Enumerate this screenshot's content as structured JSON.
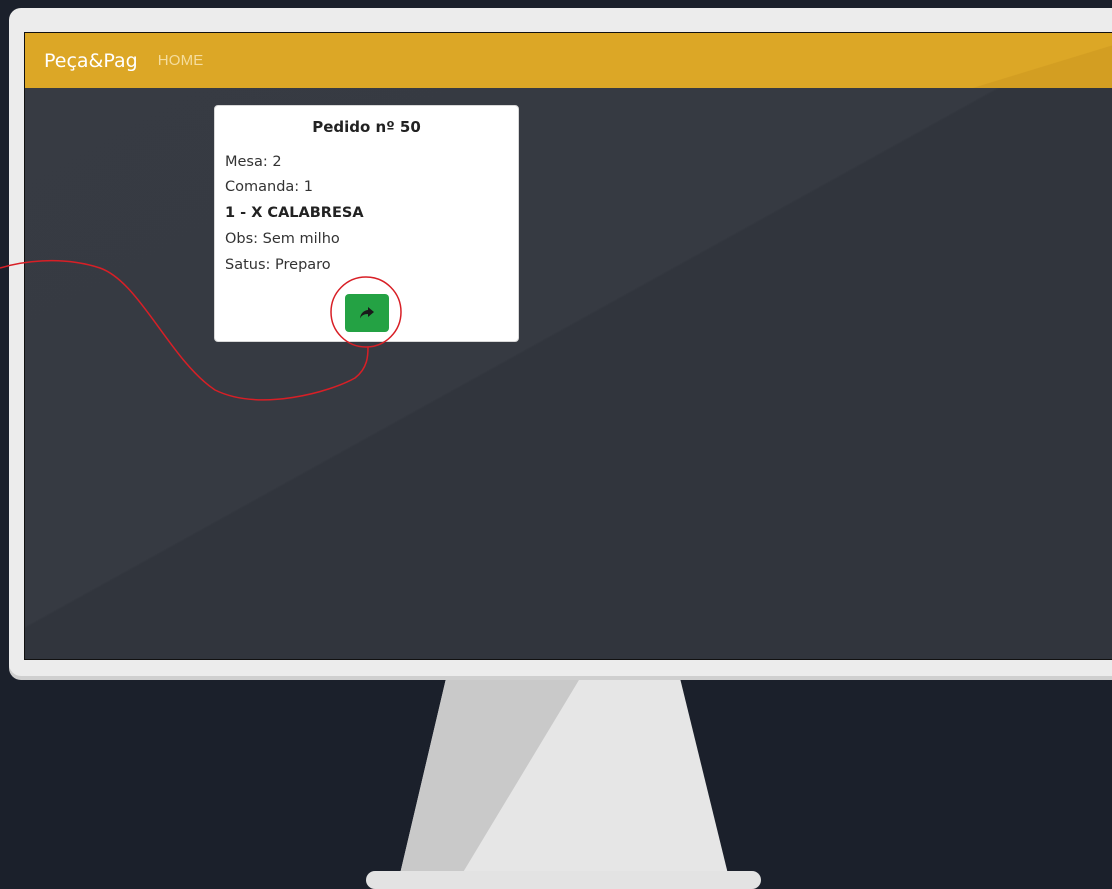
{
  "navbar": {
    "brand": "Peça&Pag",
    "home_link": "HOME"
  },
  "order_card": {
    "title": "Pedido nº 50",
    "mesa": "Mesa: 2",
    "comanda": "Comanda: 1",
    "item": "1 - X CALABRESA",
    "obs": "Obs: Sem milho",
    "status": "Satus: Preparo",
    "advance_button_icon": "share-forward-icon"
  },
  "colors": {
    "navbar": "#dca726",
    "screen_bg": "#363a42",
    "button": "#24a244",
    "annotation": "#d81f26"
  }
}
